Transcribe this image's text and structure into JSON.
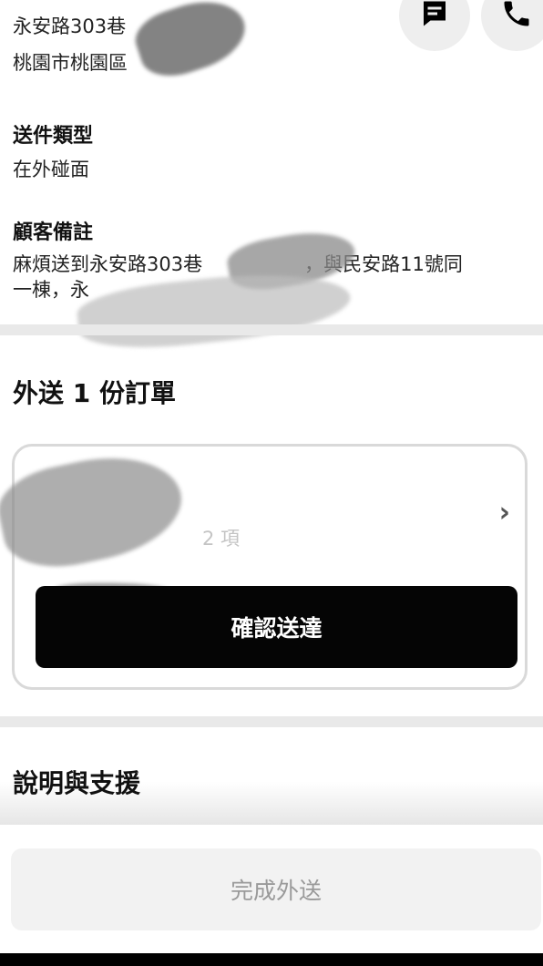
{
  "address": {
    "line1": "永安路303巷",
    "line2": "桃園市桃園區"
  },
  "actions": {
    "message_icon": "message-icon",
    "phone_icon": "phone-icon"
  },
  "delivery_type": {
    "label": "送件類型",
    "value": "在外碰面"
  },
  "customer_note": {
    "label": "顧客備註",
    "line1_prefix": "麻煩送到永安路303巷",
    "line1_suffix": "，與民安路11號同",
    "line2_prefix": "一棟，永"
  },
  "orders": {
    "title": "外送 1 份訂單",
    "item_count_suffix": "2 項",
    "confirm_button": "確認送達"
  },
  "help": {
    "title": "說明與支援"
  },
  "footer": {
    "complete_button": "完成外送"
  }
}
